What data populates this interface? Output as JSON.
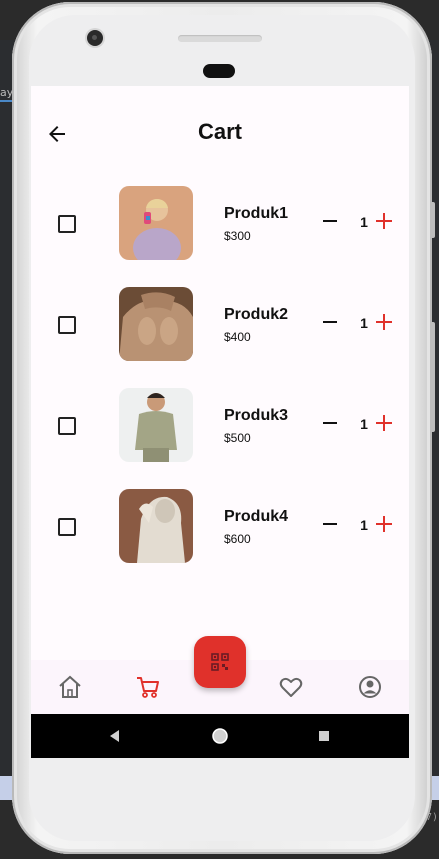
{
  "ide": {
    "left_fragment": "ayo",
    "right_fragment": "7)"
  },
  "appbar": {
    "title": "Cart",
    "back_icon": "arrow-left-icon"
  },
  "cart": {
    "items": [
      {
        "name": "Produk1",
        "price": "$300",
        "quantity": "1",
        "checked": false
      },
      {
        "name": "Produk2",
        "price": "$400",
        "quantity": "1",
        "checked": false
      },
      {
        "name": "Produk3",
        "price": "$500",
        "quantity": "1",
        "checked": false
      },
      {
        "name": "Produk4",
        "price": "$600",
        "quantity": "1",
        "checked": false
      }
    ]
  },
  "bottom_nav": {
    "items": [
      "home-icon",
      "cart-icon",
      "qr-code-icon",
      "heart-icon",
      "account-icon"
    ],
    "active": "cart-icon"
  },
  "system_nav": [
    "back-triangle-icon",
    "home-circle-icon",
    "recents-square-icon"
  ],
  "colors": {
    "accent": "#e0312b",
    "screen_bg": "#fffbfe",
    "nav_bg": "#fcf5fc",
    "icon_gray": "#666666"
  }
}
